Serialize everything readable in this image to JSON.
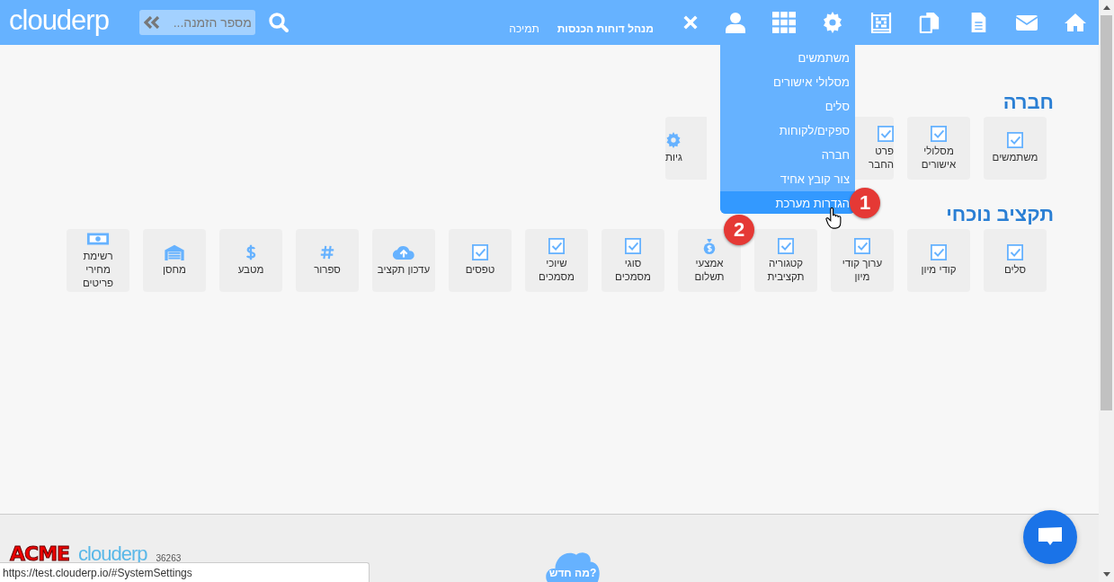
{
  "header": {
    "logo": "clouderp",
    "search": {
      "placeholder": "מספר הזמנה..."
    },
    "links": [
      "מנהל דוחות הכנסות",
      "תמיכה"
    ]
  },
  "user_menu": {
    "items": [
      {
        "label": "משתמשים",
        "selected": false
      },
      {
        "label": "מסלולי אישורים",
        "selected": false
      },
      {
        "label": "סלים",
        "selected": false
      },
      {
        "label": "ספקים/לקוחות",
        "selected": false
      },
      {
        "label": "חברה",
        "selected": false
      },
      {
        "label": "צור קובץ אחיד",
        "selected": false
      },
      {
        "label": "הגדרות מערכת",
        "selected": true
      }
    ]
  },
  "step_badges": [
    "1",
    "2"
  ],
  "sections": [
    {
      "title": "חברה",
      "tiles": [
        {
          "kind": "check",
          "lines": [
            "משתמשים"
          ]
        },
        {
          "kind": "check",
          "lines": [
            "מסלולי",
            "אישורים"
          ]
        },
        {
          "kind": "check",
          "lines": [
            "פרט",
            "החבר"
          ]
        },
        {
          "kind": "gear",
          "lines": [
            "גיות"
          ]
        }
      ]
    },
    {
      "title": "תקציב נוכחי",
      "tiles": [
        {
          "kind": "check",
          "lines": [
            "סלים"
          ]
        },
        {
          "kind": "check",
          "lines": [
            "קודי מיון"
          ]
        },
        {
          "kind": "check",
          "lines": [
            "ערוך קודי",
            "מיון"
          ]
        },
        {
          "kind": "check",
          "lines": [
            "קטגוריה",
            "תקציבית"
          ]
        },
        {
          "kind": "bag",
          "lines": [
            "אמצעי",
            "תשלום"
          ]
        },
        {
          "kind": "check",
          "lines": [
            "סוגי",
            "מסמכים"
          ]
        },
        {
          "kind": "check",
          "lines": [
            "שיוכי",
            "מסמכים"
          ]
        },
        {
          "kind": "check",
          "lines": [
            "טפסים"
          ]
        },
        {
          "kind": "cloud",
          "lines": [
            "עדכון תקציב"
          ]
        },
        {
          "kind": "hash",
          "lines": [
            "ספרור"
          ]
        },
        {
          "kind": "dollar",
          "lines": [
            "מטבע"
          ]
        },
        {
          "kind": "warehouse",
          "lines": [
            "מחסן"
          ]
        },
        {
          "kind": "banknote",
          "lines": [
            "רשימת",
            "מחירי",
            "פריטים"
          ]
        }
      ]
    }
  ],
  "footer": {
    "brand": "ACME",
    "logo": "clouderp",
    "number": "36263",
    "whats_new": "מה חדש?"
  },
  "status_url": "https://test.clouderp.io/#SystemSettings"
}
